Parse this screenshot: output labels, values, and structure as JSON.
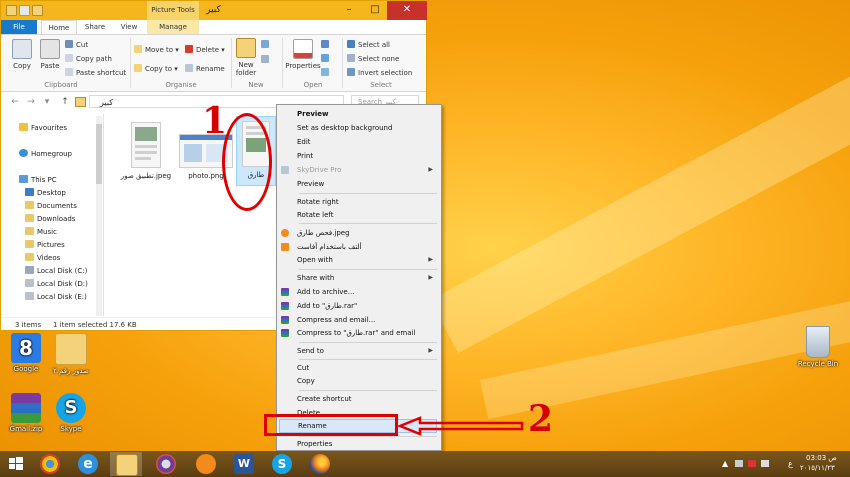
{
  "window": {
    "title": "كبير",
    "picture_tools": "Picture Tools",
    "minimize": "–",
    "maximize": "□",
    "close": "✕"
  },
  "tabs": [
    {
      "label": "File"
    },
    {
      "label": "Home"
    },
    {
      "label": "Share"
    },
    {
      "label": "View"
    },
    {
      "label": "Manage"
    }
  ],
  "ribbon": {
    "copy": "Copy",
    "paste": "Paste",
    "cut": "Cut",
    "copy_path": "Copy path",
    "paste_shortcut": "Paste shortcut",
    "clipboard": "Clipboard",
    "move_to": "Move to ▾",
    "copy_to": "Copy to ▾",
    "delete": "Delete ▾",
    "rename": "Rename",
    "organise": "Organise",
    "new_folder_1": "New",
    "new_folder_2": "folder",
    "new": "New",
    "properties": "Properties",
    "open": "Open",
    "select_all": "Select all",
    "select_none": "Select none",
    "invert_selection": "Invert selection",
    "select": "Select"
  },
  "address": {
    "path": "كبير",
    "search_placeholder": "Search كبير"
  },
  "nav": [
    {
      "label": "Favourites"
    },
    {
      "label": "Homegroup"
    },
    {
      "label": "This PC"
    },
    {
      "label": "Desktop"
    },
    {
      "label": "Documents"
    },
    {
      "label": "Downloads"
    },
    {
      "label": "Music"
    },
    {
      "label": "Pictures"
    },
    {
      "label": "Videos"
    },
    {
      "label": "Local Disk (C:)"
    },
    {
      "label": "Local Disk (D:)"
    },
    {
      "label": "Local Disk (E:)"
    }
  ],
  "files": [
    {
      "name": "تطبيق صور.jpeg"
    },
    {
      "name": "photo.png"
    },
    {
      "name": "طارق"
    }
  ],
  "status": {
    "items": "3 items",
    "selected": "1 item selected  17.6 KB"
  },
  "context_menu": {
    "preview": "Preview",
    "set_bg": "Set as desktop background",
    "edit": "Edit",
    "print": "Print",
    "skydrive": "SkyDrive Pro",
    "preview2": "Preview",
    "rotate_right": "Rotate right",
    "rotate_left": "Rotate left",
    "scan": "فحص طارق.jpeg",
    "shred": "ألتف باستخدام أفاست",
    "open_with": "Open with",
    "share_with": "Share with",
    "add_archive": "Add to archive...",
    "add_rar": "Add to \"طارق.rar\"",
    "compress_email": "Compress and email...",
    "compress_rar_email": "Compress to \"طارق.rar\" and email",
    "send_to": "Send to",
    "cut": "Cut",
    "copy": "Copy",
    "create_shortcut": "Create shortcut",
    "delete": "Delete",
    "rename": "Rename",
    "properties": "Properties"
  },
  "annotations": {
    "one": "1",
    "two": "2"
  },
  "desktop": [
    {
      "label": "Google"
    },
    {
      "label": "صدور رقم ٢"
    },
    {
      "label": "Gmail.zip"
    },
    {
      "label": "Skype"
    },
    {
      "label": "Recycle Bin"
    }
  ],
  "tray": {
    "time": "03:03 ص",
    "date": "٢٠١٥/١١/٢٣",
    "lang": "ع"
  },
  "colors": {
    "accent": "#1979ca",
    "annotation": "#e00000",
    "titlebar": "#f5b51c"
  }
}
